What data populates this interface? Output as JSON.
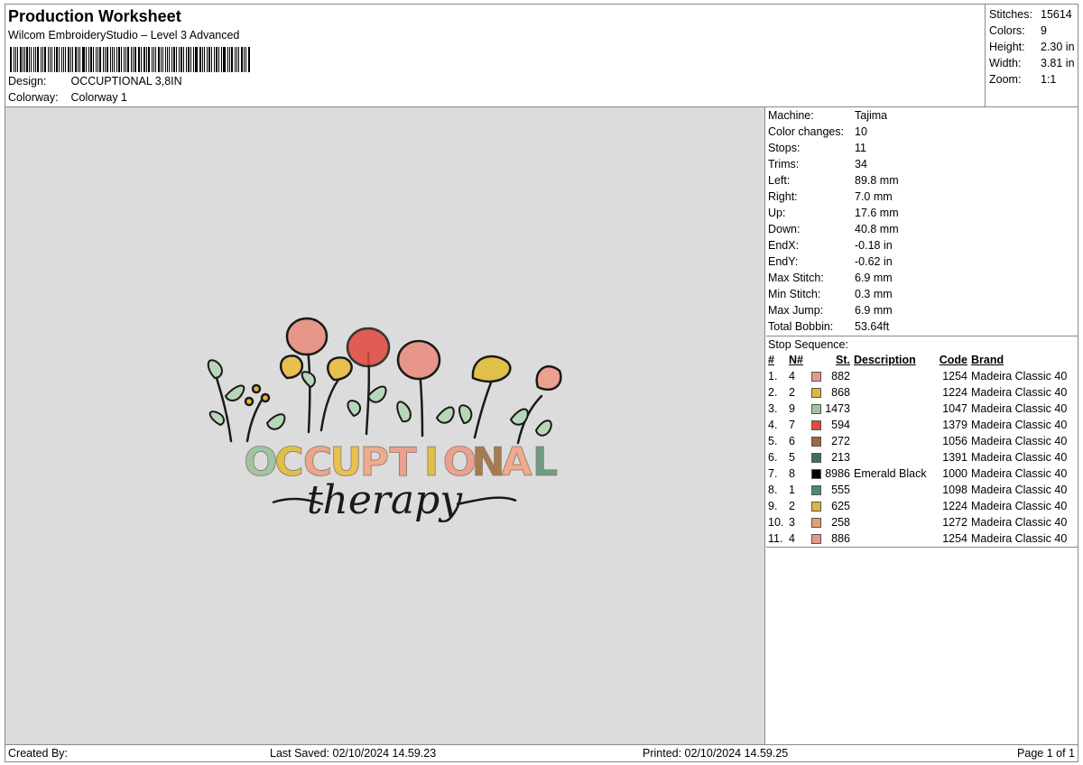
{
  "header": {
    "title": "Production Worksheet",
    "subtitle": "Wilcom EmbroideryStudio – Level 3 Advanced",
    "design_label": "Design:",
    "design_value": "OCCUPTIONAL 3,8IN",
    "colorway_label": "Colorway:",
    "colorway_value": "Colorway 1"
  },
  "stats": [
    {
      "label": "Stitches:",
      "value": "15614"
    },
    {
      "label": "Colors:",
      "value": "9"
    },
    {
      "label": "Height:",
      "value": "2.30 in"
    },
    {
      "label": "Width:",
      "value": "3.81 in"
    },
    {
      "label": "Zoom:",
      "value": "1:1"
    }
  ],
  "machine_info": [
    {
      "label": "Machine:",
      "value": "Tajima"
    },
    {
      "label": "Color changes:",
      "value": "10"
    },
    {
      "label": "Stops:",
      "value": "11"
    },
    {
      "label": "Trims:",
      "value": "34"
    },
    {
      "label": "Left:",
      "value": "89.8 mm"
    },
    {
      "label": "Right:",
      "value": "7.0 mm"
    },
    {
      "label": "Up:",
      "value": "17.6 mm"
    },
    {
      "label": "Down:",
      "value": "40.8 mm"
    },
    {
      "label": "EndX:",
      "value": "-0.18 in"
    },
    {
      "label": "EndY:",
      "value": "-0.62 in"
    },
    {
      "label": "Max Stitch:",
      "value": "6.9 mm"
    },
    {
      "label": "Min Stitch:",
      "value": "0.3 mm"
    },
    {
      "label": "Max Jump:",
      "value": "6.9 mm"
    },
    {
      "label": "Total Bobbin:",
      "value": "53.64ft"
    }
  ],
  "stop_sequence": {
    "title": "Stop Sequence:",
    "columns": [
      "#",
      "N#",
      "St.",
      "Description",
      "Code",
      "Brand"
    ],
    "rows": [
      {
        "idx": "1.",
        "n": "4",
        "color": "#e8968a",
        "st": "882",
        "desc": "",
        "code": "1254",
        "brand": "Madeira Classic 40"
      },
      {
        "idx": "2.",
        "n": "2",
        "color": "#e0b63a",
        "st": "868",
        "desc": "",
        "code": "1224",
        "brand": "Madeira Classic 40"
      },
      {
        "idx": "3.",
        "n": "9",
        "color": "#9fc4a0",
        "st": "1473",
        "desc": "",
        "code": "1047",
        "brand": "Madeira Classic 40"
      },
      {
        "idx": "4.",
        "n": "7",
        "color": "#e0483a",
        "st": "594",
        "desc": "",
        "code": "1379",
        "brand": "Madeira Classic 40"
      },
      {
        "idx": "5.",
        "n": "6",
        "color": "#9a6a48",
        "st": "272",
        "desc": "",
        "code": "1056",
        "brand": "Madeira Classic 40"
      },
      {
        "idx": "6.",
        "n": "5",
        "color": "#3f6e5a",
        "st": "213",
        "desc": "",
        "code": "1391",
        "brand": "Madeira Classic 40"
      },
      {
        "idx": "7.",
        "n": "8",
        "color": "#000000",
        "st": "8986",
        "desc": "Emerald Black",
        "code": "1000",
        "brand": "Madeira Classic 40"
      },
      {
        "idx": "8.",
        "n": "1",
        "color": "#4e8a6e",
        "st": "555",
        "desc": "",
        "code": "1098",
        "brand": "Madeira Classic 40"
      },
      {
        "idx": "9.",
        "n": "2",
        "color": "#e0b63a",
        "st": "625",
        "desc": "",
        "code": "1224",
        "brand": "Madeira Classic 40"
      },
      {
        "idx": "10.",
        "n": "3",
        "color": "#e3a070",
        "st": "258",
        "desc": "",
        "code": "1272",
        "brand": "Madeira Classic 40"
      },
      {
        "idx": "11.",
        "n": "4",
        "color": "#e8968a",
        "st": "886",
        "desc": "",
        "code": "1254",
        "brand": "Madeira Classic 40"
      }
    ]
  },
  "design_text": {
    "main": "OCCUPTIONAL",
    "script": "therapy",
    "letter_colors": [
      "#9fc4a0",
      "#e0c048",
      "#eaa68a",
      "#e8c050",
      "#f0aa8e",
      "#eba090",
      "#e0c048",
      "#eba090",
      "#a87a52",
      "#f0aa8e",
      "#6f9c82"
    ]
  },
  "footer": {
    "created": "Created By:",
    "saved": "Last Saved: 02/10/2024 14.59.23",
    "printed": "Printed: 02/10/2024 14.59.25",
    "page": "Page 1 of 1"
  }
}
